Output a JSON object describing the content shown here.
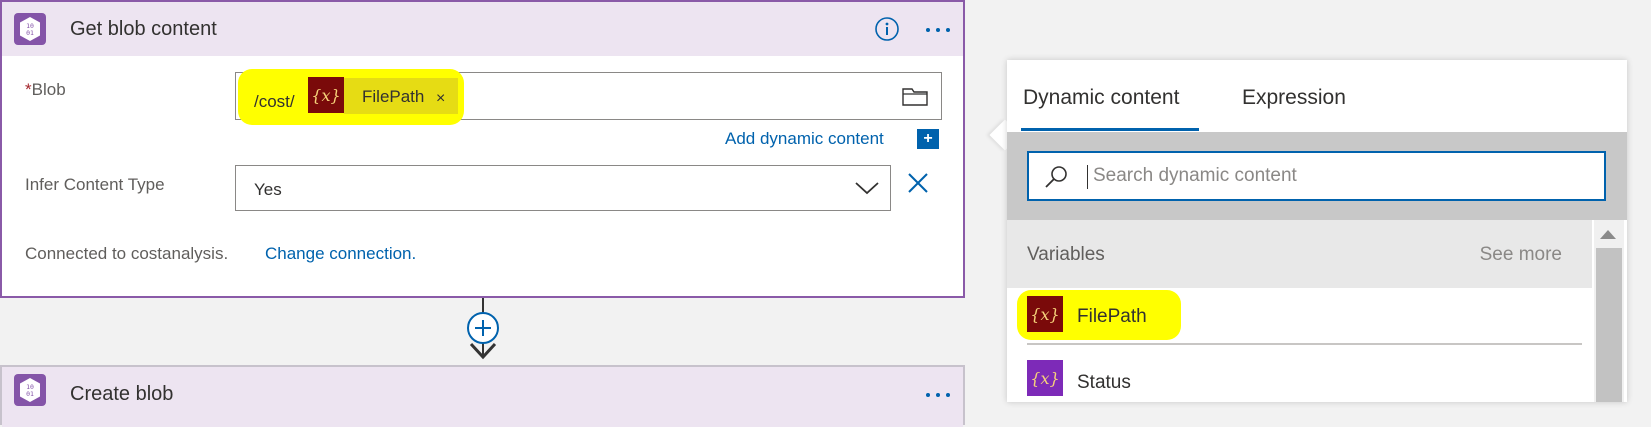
{
  "get_blob_card": {
    "title": "Get blob content",
    "blob_label": "Blob",
    "required_marker": "*",
    "blob_path_prefix": "/cost/",
    "blob_token": {
      "label": "FilePath",
      "icon": "{x}",
      "remove": "×"
    },
    "add_dynamic_content": "Add dynamic content",
    "add_dynamic_plus": "+",
    "infer_label": "Infer Content Type",
    "infer_value": "Yes",
    "connected_text": "Connected to costanalysis.",
    "change_connection": "Change connection."
  },
  "create_blob_card": {
    "title": "Create blob"
  },
  "dynamic_panel": {
    "tabs": [
      {
        "label": "Dynamic content",
        "active": true
      },
      {
        "label": "Expression",
        "active": false
      }
    ],
    "search_placeholder": "Search dynamic content",
    "section_title": "Variables",
    "see_more": "See more",
    "items": [
      {
        "name": "FilePath",
        "icon": "{x}",
        "icon_color": "#7a0a0a",
        "highlighted": true
      },
      {
        "name": "Status",
        "icon": "{x}",
        "icon_color": "#7d2ab8",
        "highlighted": false
      }
    ]
  },
  "colors": {
    "card_border": "#8a5aa8",
    "header_bg": "#ede4f1",
    "link": "#0062ad",
    "highlight": "#ffff00"
  }
}
